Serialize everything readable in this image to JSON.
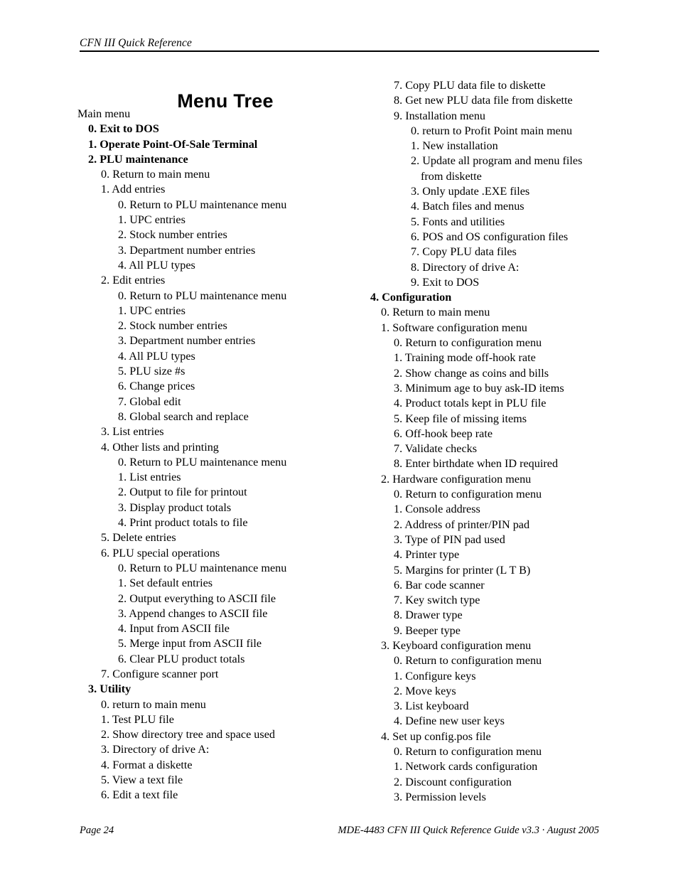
{
  "header": {
    "running_head": "CFN III Quick Reference"
  },
  "title": "Menu Tree",
  "footer": {
    "left": "Page 24",
    "right": "MDE-4483 CFN III Quick Reference Guide v3.3 · August 2005"
  },
  "left_column": [
    {
      "level": 0,
      "bold": false,
      "text": "Main menu"
    },
    {
      "level": 1,
      "bold": true,
      "text": "0. Exit to DOS"
    },
    {
      "level": 1,
      "bold": true,
      "text": "1. Operate Point-Of-Sale Terminal"
    },
    {
      "level": 1,
      "bold": true,
      "text": "2. PLU maintenance"
    },
    {
      "level": 2,
      "bold": false,
      "text": "0. Return to main menu"
    },
    {
      "level": 2,
      "bold": false,
      "text": "1. Add entries"
    },
    {
      "level": 3,
      "bold": false,
      "text": "0. Return to PLU maintenance menu"
    },
    {
      "level": 3,
      "bold": false,
      "text": "1. UPC entries"
    },
    {
      "level": 3,
      "bold": false,
      "text": "2. Stock number entries"
    },
    {
      "level": 3,
      "bold": false,
      "text": "3. Department number entries"
    },
    {
      "level": 3,
      "bold": false,
      "text": "4. All PLU types"
    },
    {
      "level": 2,
      "bold": false,
      "text": "2. Edit entries"
    },
    {
      "level": 3,
      "bold": false,
      "text": "0. Return to PLU maintenance menu"
    },
    {
      "level": 3,
      "bold": false,
      "text": "1. UPC entries"
    },
    {
      "level": 3,
      "bold": false,
      "text": "2. Stock number entries"
    },
    {
      "level": 3,
      "bold": false,
      "text": "3. Department number entries"
    },
    {
      "level": 3,
      "bold": false,
      "text": "4. All PLU types"
    },
    {
      "level": 3,
      "bold": false,
      "text": "5. PLU size #s"
    },
    {
      "level": 3,
      "bold": false,
      "text": "6. Change prices"
    },
    {
      "level": 3,
      "bold": false,
      "text": "7. Global edit"
    },
    {
      "level": 3,
      "bold": false,
      "text": "8. Global search and replace"
    },
    {
      "level": 2,
      "bold": false,
      "text": "3. List entries"
    },
    {
      "level": 2,
      "bold": false,
      "text": "4. Other lists and printing"
    },
    {
      "level": 3,
      "bold": false,
      "text": "0. Return to PLU maintenance menu"
    },
    {
      "level": 3,
      "bold": false,
      "text": "1. List entries"
    },
    {
      "level": 3,
      "bold": false,
      "text": "2. Output to file for printout"
    },
    {
      "level": 3,
      "bold": false,
      "text": "3. Display product totals"
    },
    {
      "level": 3,
      "bold": false,
      "text": "4. Print product totals to file"
    },
    {
      "level": 2,
      "bold": false,
      "text": "5. Delete entries"
    },
    {
      "level": 2,
      "bold": false,
      "text": "6. PLU special operations"
    },
    {
      "level": 3,
      "bold": false,
      "text": "0. Return to PLU maintenance menu"
    },
    {
      "level": 3,
      "bold": false,
      "text": "1. Set default entries"
    },
    {
      "level": 3,
      "bold": false,
      "text": "2. Output everything to ASCII file"
    },
    {
      "level": 3,
      "bold": false,
      "text": "3. Append changes to ASCII file"
    },
    {
      "level": 3,
      "bold": false,
      "text": "4. Input from ASCII file"
    },
    {
      "level": 3,
      "bold": false,
      "text": "5. Merge input from ASCII file"
    },
    {
      "level": 3,
      "bold": false,
      "text": "6. Clear PLU product totals"
    },
    {
      "level": 2,
      "bold": false,
      "text": "7. Configure scanner port"
    },
    {
      "level": 1,
      "bold": true,
      "text": "3. Utility"
    },
    {
      "level": 2,
      "bold": false,
      "text": "0. return to main menu"
    },
    {
      "level": 2,
      "bold": false,
      "text": "1. Test PLU file"
    },
    {
      "level": 2,
      "bold": false,
      "text": "2. Show directory tree and space used"
    },
    {
      "level": 2,
      "bold": false,
      "text": "3. Directory of drive A:"
    },
    {
      "level": 2,
      "bold": false,
      "text": "4. Format a diskette"
    },
    {
      "level": 2,
      "bold": false,
      "text": "5. View a text file"
    },
    {
      "level": 2,
      "bold": false,
      "text": "6. Edit a text file"
    }
  ],
  "right_column": [
    {
      "level": 2,
      "bold": false,
      "text": "7. Copy PLU data file to diskette"
    },
    {
      "level": 2,
      "bold": false,
      "text": "8. Get new PLU data file from diskette"
    },
    {
      "level": 2,
      "bold": false,
      "text": "9. Installation menu"
    },
    {
      "level": 3,
      "bold": false,
      "text": "0. return to Profit Point main menu"
    },
    {
      "level": 3,
      "bold": false,
      "text": "1. New installation"
    },
    {
      "level": 3,
      "bold": false,
      "text": "2. Update all program and menu files"
    },
    {
      "level": 3,
      "bold": false,
      "text": "from diskette",
      "continuation": true
    },
    {
      "level": 3,
      "bold": false,
      "text": "3. Only update .EXE files"
    },
    {
      "level": 3,
      "bold": false,
      "text": "4. Batch files and menus"
    },
    {
      "level": 3,
      "bold": false,
      "text": "5. Fonts and utilities"
    },
    {
      "level": 3,
      "bold": false,
      "text": "6. POS and OS configuration files"
    },
    {
      "level": 3,
      "bold": false,
      "text": "7. Copy PLU data files"
    },
    {
      "level": 3,
      "bold": false,
      "text": "8. Directory of drive A:"
    },
    {
      "level": 3,
      "bold": false,
      "text": "9. Exit to DOS"
    },
    {
      "level": 0,
      "bold": true,
      "text": "4. Configuration"
    },
    {
      "level": 1,
      "bold": false,
      "text": "0. Return to main menu"
    },
    {
      "level": 1,
      "bold": false,
      "text": "1. Software configuration menu"
    },
    {
      "level": 2,
      "bold": false,
      "text": "0. Return to configuration menu"
    },
    {
      "level": 2,
      "bold": false,
      "text": "1. Training mode off-hook rate"
    },
    {
      "level": 2,
      "bold": false,
      "text": "2. Show change as coins and bills"
    },
    {
      "level": 2,
      "bold": false,
      "text": "3. Minimum age to buy ask-ID items"
    },
    {
      "level": 2,
      "bold": false,
      "text": "4. Product totals kept in PLU file"
    },
    {
      "level": 2,
      "bold": false,
      "text": "5. Keep file of missing items"
    },
    {
      "level": 2,
      "bold": false,
      "text": "6. Off-hook beep rate"
    },
    {
      "level": 2,
      "bold": false,
      "text": "7. Validate checks"
    },
    {
      "level": 2,
      "bold": false,
      "text": "8. Enter birthdate when ID required"
    },
    {
      "level": 1,
      "bold": false,
      "text": "2. Hardware configuration menu"
    },
    {
      "level": 2,
      "bold": false,
      "text": "0. Return to configuration menu"
    },
    {
      "level": 2,
      "bold": false,
      "text": "1. Console address"
    },
    {
      "level": 2,
      "bold": false,
      "text": "2. Address of printer/PIN pad"
    },
    {
      "level": 2,
      "bold": false,
      "text": "3. Type of PIN pad used"
    },
    {
      "level": 2,
      "bold": false,
      "text": "4. Printer type"
    },
    {
      "level": 2,
      "bold": false,
      "text": "5. Margins for printer (L T B)"
    },
    {
      "level": 2,
      "bold": false,
      "text": "6. Bar code scanner"
    },
    {
      "level": 2,
      "bold": false,
      "text": "7. Key switch type"
    },
    {
      "level": 2,
      "bold": false,
      "text": "8. Drawer type"
    },
    {
      "level": 2,
      "bold": false,
      "text": "9. Beeper type"
    },
    {
      "level": 1,
      "bold": false,
      "text": "3. Keyboard configuration menu"
    },
    {
      "level": 2,
      "bold": false,
      "text": "0. Return to configuration menu"
    },
    {
      "level": 2,
      "bold": false,
      "text": "1. Configure keys"
    },
    {
      "level": 2,
      "bold": false,
      "text": "2. Move keys"
    },
    {
      "level": 2,
      "bold": false,
      "text": "3. List keyboard"
    },
    {
      "level": 2,
      "bold": false,
      "text": "4. Define new user keys"
    },
    {
      "level": 1,
      "bold": false,
      "text": "4. Set up config.pos file"
    },
    {
      "level": 2,
      "bold": false,
      "text": "0. Return to configuration menu"
    },
    {
      "level": 2,
      "bold": false,
      "text": "1. Network cards configuration"
    },
    {
      "level": 2,
      "bold": false,
      "text": "2. Discount configuration"
    },
    {
      "level": 2,
      "bold": false,
      "text": "3. Permission levels"
    }
  ]
}
